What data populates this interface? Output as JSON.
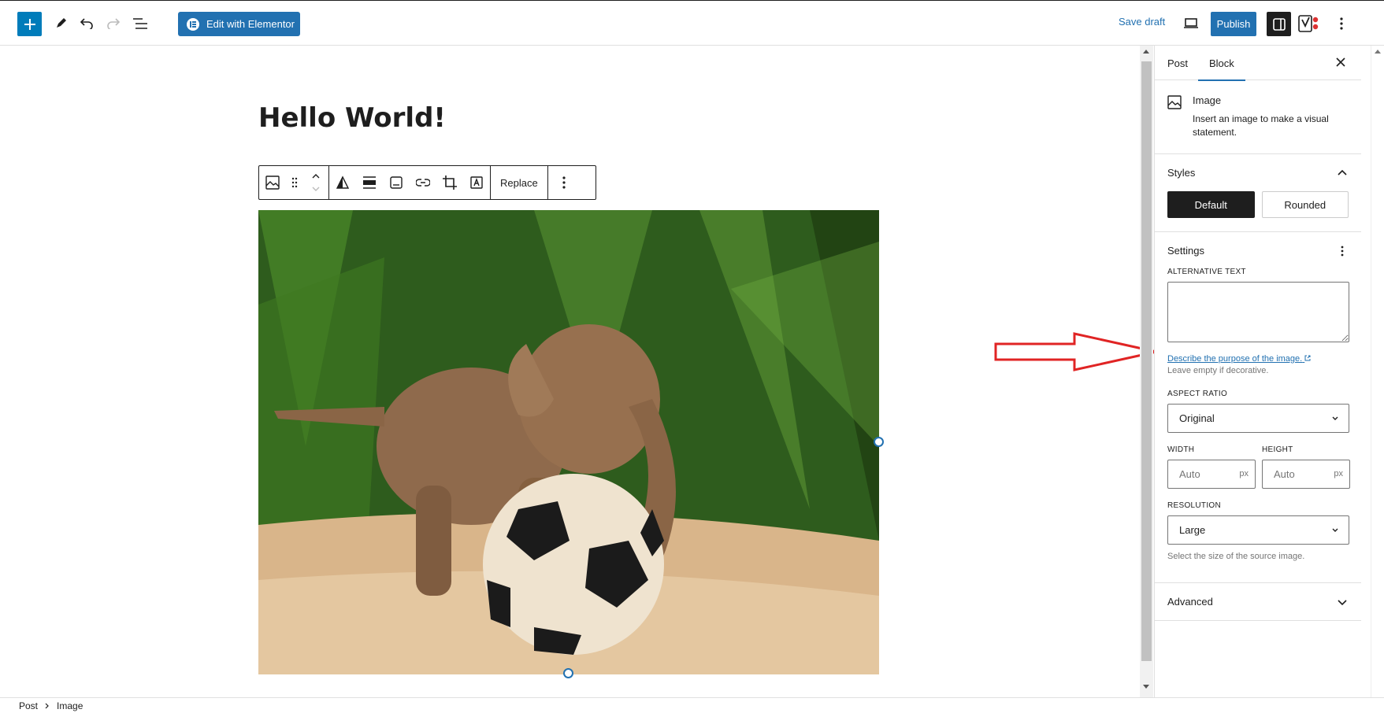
{
  "toolbar": {
    "edit_elementor_label": "Edit with Elementor",
    "save_draft_label": "Save draft",
    "publish_label": "Publish"
  },
  "post": {
    "title": "Hello World!"
  },
  "block_toolbar": {
    "replace_label": "Replace"
  },
  "sidebar": {
    "tabs": [
      {
        "label": "Post"
      },
      {
        "label": "Block"
      }
    ],
    "active_tab": "Block",
    "block": {
      "title": "Image",
      "description": "Insert an image to make a visual statement."
    },
    "styles": {
      "title": "Styles",
      "options": [
        {
          "label": "Default",
          "selected": true
        },
        {
          "label": "Rounded",
          "selected": false
        }
      ]
    },
    "settings": {
      "title": "Settings",
      "alt_label": "ALTERNATIVE TEXT",
      "alt_value": "",
      "alt_help_link": "Describe the purpose of the image.",
      "alt_help_text": "Leave empty if decorative.",
      "aspect_label": "ASPECT RATIO",
      "aspect_value": "Original",
      "width_label": "WIDTH",
      "width_placeholder": "Auto",
      "height_label": "HEIGHT",
      "height_placeholder": "Auto",
      "unit": "px",
      "resolution_label": "RESOLUTION",
      "resolution_value": "Large",
      "resolution_help": "Select the size of the source image."
    },
    "advanced": {
      "title": "Advanced"
    }
  },
  "breadcrumbs": {
    "items": [
      "Post",
      "Image"
    ]
  },
  "colors": {
    "accent": "#2271b1",
    "dark": "#1e1e1e",
    "annotation": "#e02424"
  }
}
